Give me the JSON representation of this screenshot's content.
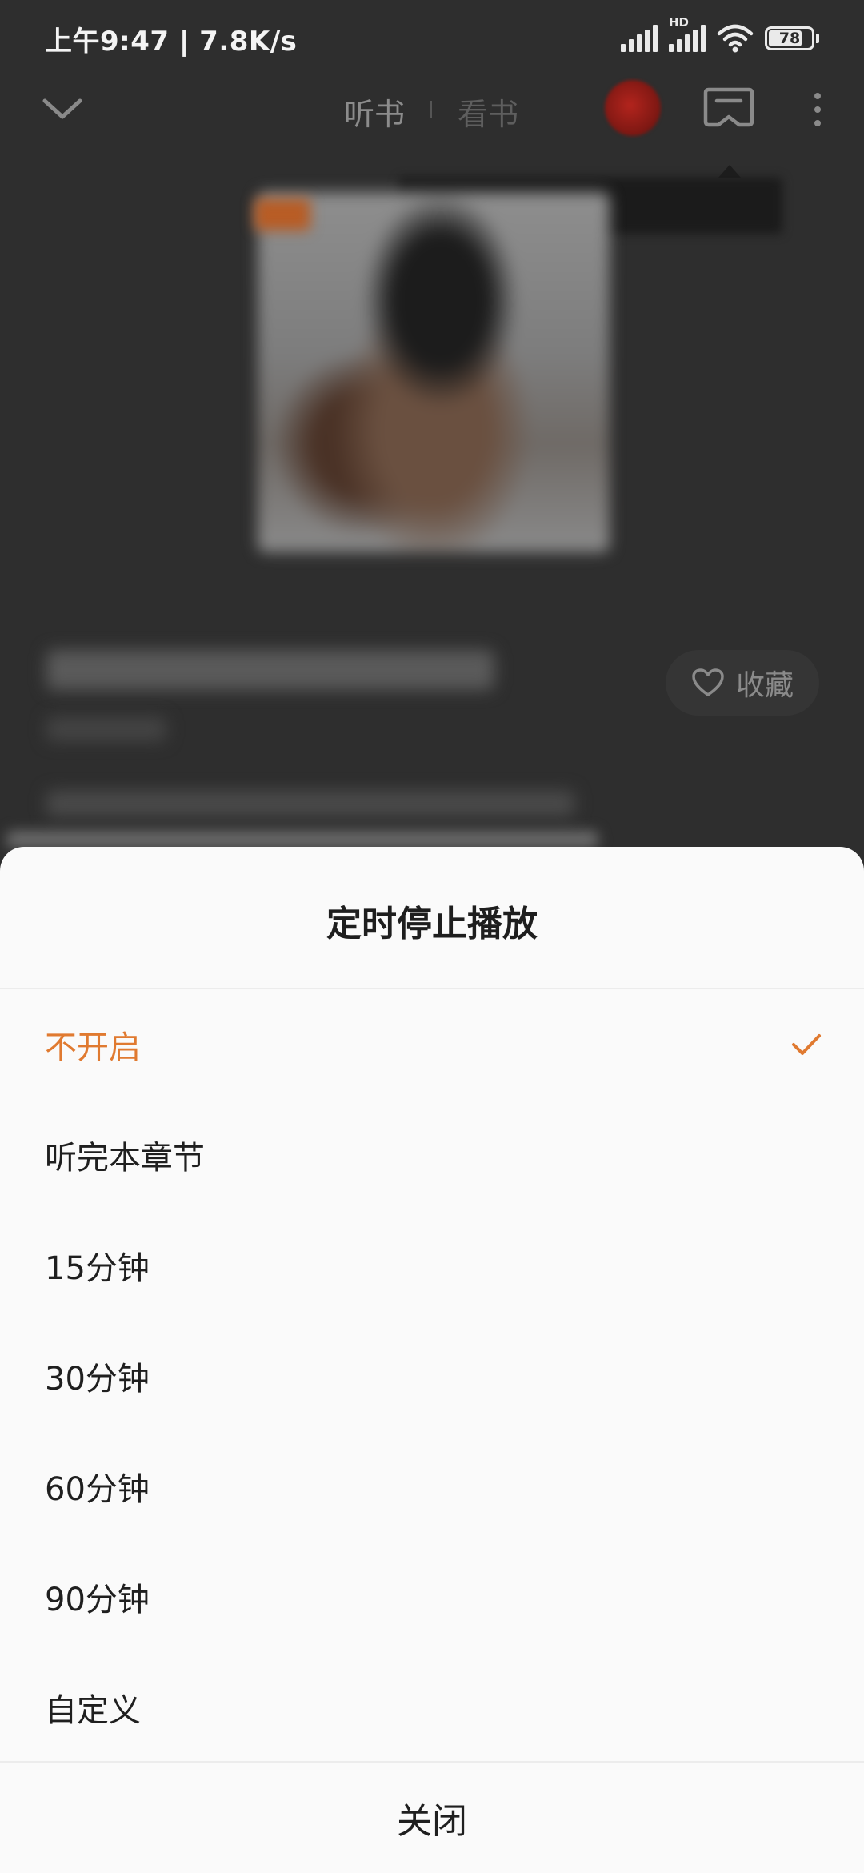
{
  "status_bar": {
    "time": "上午9:47 | 7.8K/s",
    "network_type": "HD",
    "battery_level": "78",
    "battery_fraction": 0.78,
    "icons": [
      "signal-icon",
      "hd-signal-icon",
      "wifi-icon",
      "battery-icon"
    ]
  },
  "top_bar": {
    "back_icon": "chevron-down-icon",
    "tabs": [
      {
        "label": "听书",
        "active": true
      },
      {
        "label": "看书",
        "active": false
      }
    ],
    "cast_icon": "cast-icon",
    "more_icon": "more-icon"
  },
  "book": {
    "favorite_label": "收藏",
    "favorite_icon": "heart-icon"
  },
  "timer_sheet": {
    "title": "定时停止播放",
    "options": [
      {
        "label": "不开启",
        "selected": true
      },
      {
        "label": "听完本章节",
        "selected": false
      },
      {
        "label": "15分钟",
        "selected": false
      },
      {
        "label": "30分钟",
        "selected": false
      },
      {
        "label": "60分钟",
        "selected": false
      },
      {
        "label": "90分钟",
        "selected": false
      },
      {
        "label": "自定义",
        "selected": false
      }
    ],
    "close_label": "关闭"
  },
  "colors": {
    "accent": "#e07a30",
    "sheet_background": "#fafafa",
    "overlay_background": "#2b2b2b"
  }
}
